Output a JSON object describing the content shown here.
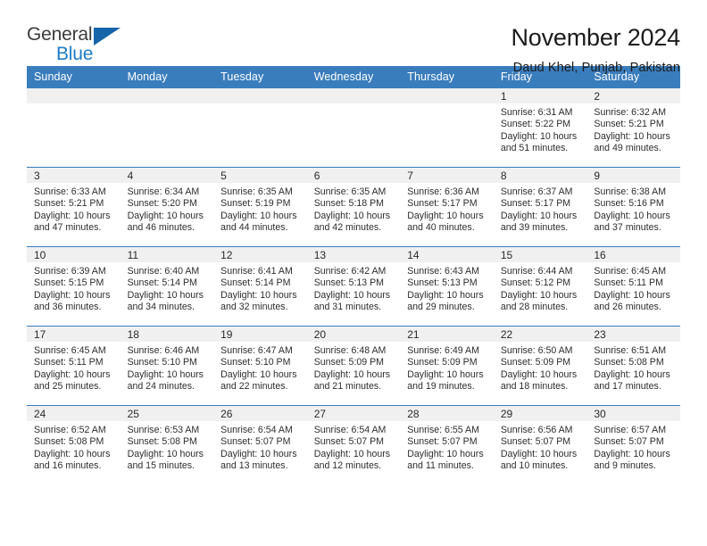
{
  "brand": {
    "line1": "General",
    "line2": "Blue",
    "triangle_color": "#1565a8",
    "line2_color": "#1d7cc4"
  },
  "header": {
    "title": "November 2024",
    "subtitle": "Daud Khel, Punjab, Pakistan"
  },
  "colors": {
    "header_row": "#3a7dbd",
    "daynum_band": "#f0f0f0",
    "cell_border": "#3a7dbd",
    "text": "#2d2d2d"
  },
  "weekday_headers": [
    "Sunday",
    "Monday",
    "Tuesday",
    "Wednesday",
    "Thursday",
    "Friday",
    "Saturday"
  ],
  "labels": {
    "sunrise_prefix": "Sunrise:",
    "sunset_prefix": "Sunset:",
    "daylight_prefix": "Daylight:"
  },
  "weeks": [
    [
      {
        "empty": true
      },
      {
        "empty": true
      },
      {
        "empty": true
      },
      {
        "empty": true
      },
      {
        "empty": true
      },
      {
        "day": "1",
        "sunrise": "Sunrise: 6:31 AM",
        "sunset": "Sunset: 5:22 PM",
        "daylight_l1": "Daylight: 10 hours",
        "daylight_l2": "and 51 minutes."
      },
      {
        "day": "2",
        "sunrise": "Sunrise: 6:32 AM",
        "sunset": "Sunset: 5:21 PM",
        "daylight_l1": "Daylight: 10 hours",
        "daylight_l2": "and 49 minutes."
      }
    ],
    [
      {
        "day": "3",
        "sunrise": "Sunrise: 6:33 AM",
        "sunset": "Sunset: 5:21 PM",
        "daylight_l1": "Daylight: 10 hours",
        "daylight_l2": "and 47 minutes."
      },
      {
        "day": "4",
        "sunrise": "Sunrise: 6:34 AM",
        "sunset": "Sunset: 5:20 PM",
        "daylight_l1": "Daylight: 10 hours",
        "daylight_l2": "and 46 minutes."
      },
      {
        "day": "5",
        "sunrise": "Sunrise: 6:35 AM",
        "sunset": "Sunset: 5:19 PM",
        "daylight_l1": "Daylight: 10 hours",
        "daylight_l2": "and 44 minutes."
      },
      {
        "day": "6",
        "sunrise": "Sunrise: 6:35 AM",
        "sunset": "Sunset: 5:18 PM",
        "daylight_l1": "Daylight: 10 hours",
        "daylight_l2": "and 42 minutes."
      },
      {
        "day": "7",
        "sunrise": "Sunrise: 6:36 AM",
        "sunset": "Sunset: 5:17 PM",
        "daylight_l1": "Daylight: 10 hours",
        "daylight_l2": "and 40 minutes."
      },
      {
        "day": "8",
        "sunrise": "Sunrise: 6:37 AM",
        "sunset": "Sunset: 5:17 PM",
        "daylight_l1": "Daylight: 10 hours",
        "daylight_l2": "and 39 minutes."
      },
      {
        "day": "9",
        "sunrise": "Sunrise: 6:38 AM",
        "sunset": "Sunset: 5:16 PM",
        "daylight_l1": "Daylight: 10 hours",
        "daylight_l2": "and 37 minutes."
      }
    ],
    [
      {
        "day": "10",
        "sunrise": "Sunrise: 6:39 AM",
        "sunset": "Sunset: 5:15 PM",
        "daylight_l1": "Daylight: 10 hours",
        "daylight_l2": "and 36 minutes."
      },
      {
        "day": "11",
        "sunrise": "Sunrise: 6:40 AM",
        "sunset": "Sunset: 5:14 PM",
        "daylight_l1": "Daylight: 10 hours",
        "daylight_l2": "and 34 minutes."
      },
      {
        "day": "12",
        "sunrise": "Sunrise: 6:41 AM",
        "sunset": "Sunset: 5:14 PM",
        "daylight_l1": "Daylight: 10 hours",
        "daylight_l2": "and 32 minutes."
      },
      {
        "day": "13",
        "sunrise": "Sunrise: 6:42 AM",
        "sunset": "Sunset: 5:13 PM",
        "daylight_l1": "Daylight: 10 hours",
        "daylight_l2": "and 31 minutes."
      },
      {
        "day": "14",
        "sunrise": "Sunrise: 6:43 AM",
        "sunset": "Sunset: 5:13 PM",
        "daylight_l1": "Daylight: 10 hours",
        "daylight_l2": "and 29 minutes."
      },
      {
        "day": "15",
        "sunrise": "Sunrise: 6:44 AM",
        "sunset": "Sunset: 5:12 PM",
        "daylight_l1": "Daylight: 10 hours",
        "daylight_l2": "and 28 minutes."
      },
      {
        "day": "16",
        "sunrise": "Sunrise: 6:45 AM",
        "sunset": "Sunset: 5:11 PM",
        "daylight_l1": "Daylight: 10 hours",
        "daylight_l2": "and 26 minutes."
      }
    ],
    [
      {
        "day": "17",
        "sunrise": "Sunrise: 6:45 AM",
        "sunset": "Sunset: 5:11 PM",
        "daylight_l1": "Daylight: 10 hours",
        "daylight_l2": "and 25 minutes."
      },
      {
        "day": "18",
        "sunrise": "Sunrise: 6:46 AM",
        "sunset": "Sunset: 5:10 PM",
        "daylight_l1": "Daylight: 10 hours",
        "daylight_l2": "and 24 minutes."
      },
      {
        "day": "19",
        "sunrise": "Sunrise: 6:47 AM",
        "sunset": "Sunset: 5:10 PM",
        "daylight_l1": "Daylight: 10 hours",
        "daylight_l2": "and 22 minutes."
      },
      {
        "day": "20",
        "sunrise": "Sunrise: 6:48 AM",
        "sunset": "Sunset: 5:09 PM",
        "daylight_l1": "Daylight: 10 hours",
        "daylight_l2": "and 21 minutes."
      },
      {
        "day": "21",
        "sunrise": "Sunrise: 6:49 AM",
        "sunset": "Sunset: 5:09 PM",
        "daylight_l1": "Daylight: 10 hours",
        "daylight_l2": "and 19 minutes."
      },
      {
        "day": "22",
        "sunrise": "Sunrise: 6:50 AM",
        "sunset": "Sunset: 5:09 PM",
        "daylight_l1": "Daylight: 10 hours",
        "daylight_l2": "and 18 minutes."
      },
      {
        "day": "23",
        "sunrise": "Sunrise: 6:51 AM",
        "sunset": "Sunset: 5:08 PM",
        "daylight_l1": "Daylight: 10 hours",
        "daylight_l2": "and 17 minutes."
      }
    ],
    [
      {
        "day": "24",
        "sunrise": "Sunrise: 6:52 AM",
        "sunset": "Sunset: 5:08 PM",
        "daylight_l1": "Daylight: 10 hours",
        "daylight_l2": "and 16 minutes."
      },
      {
        "day": "25",
        "sunrise": "Sunrise: 6:53 AM",
        "sunset": "Sunset: 5:08 PM",
        "daylight_l1": "Daylight: 10 hours",
        "daylight_l2": "and 15 minutes."
      },
      {
        "day": "26",
        "sunrise": "Sunrise: 6:54 AM",
        "sunset": "Sunset: 5:07 PM",
        "daylight_l1": "Daylight: 10 hours",
        "daylight_l2": "and 13 minutes."
      },
      {
        "day": "27",
        "sunrise": "Sunrise: 6:54 AM",
        "sunset": "Sunset: 5:07 PM",
        "daylight_l1": "Daylight: 10 hours",
        "daylight_l2": "and 12 minutes."
      },
      {
        "day": "28",
        "sunrise": "Sunrise: 6:55 AM",
        "sunset": "Sunset: 5:07 PM",
        "daylight_l1": "Daylight: 10 hours",
        "daylight_l2": "and 11 minutes."
      },
      {
        "day": "29",
        "sunrise": "Sunrise: 6:56 AM",
        "sunset": "Sunset: 5:07 PM",
        "daylight_l1": "Daylight: 10 hours",
        "daylight_l2": "and 10 minutes."
      },
      {
        "day": "30",
        "sunrise": "Sunrise: 6:57 AM",
        "sunset": "Sunset: 5:07 PM",
        "daylight_l1": "Daylight: 10 hours",
        "daylight_l2": "and 9 minutes."
      }
    ]
  ]
}
